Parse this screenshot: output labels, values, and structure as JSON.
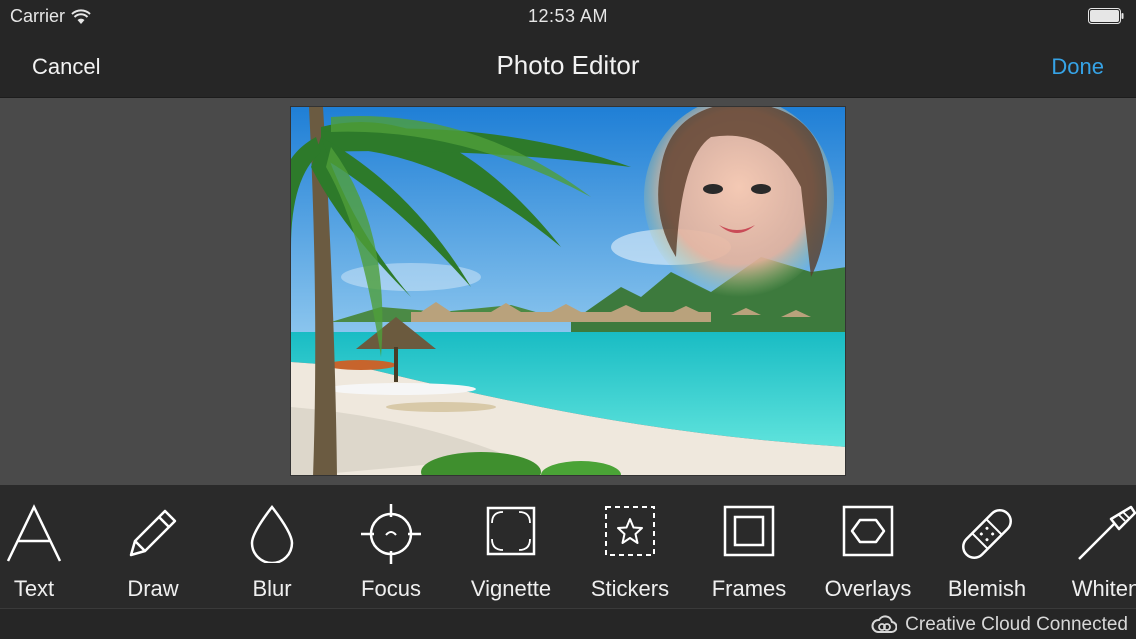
{
  "status": {
    "carrier": "Carrier",
    "time": "12:53 AM"
  },
  "nav": {
    "cancel": "Cancel",
    "title": "Photo Editor",
    "done": "Done"
  },
  "tools": [
    {
      "label": "Text",
      "icon": "text-icon"
    },
    {
      "label": "Draw",
      "icon": "pencil-icon"
    },
    {
      "label": "Blur",
      "icon": "drop-icon"
    },
    {
      "label": "Focus",
      "icon": "crosshair-icon"
    },
    {
      "label": "Vignette",
      "icon": "vignette-icon"
    },
    {
      "label": "Stickers",
      "icon": "star-icon"
    },
    {
      "label": "Frames",
      "icon": "frame-icon"
    },
    {
      "label": "Overlays",
      "icon": "hexagon-icon"
    },
    {
      "label": "Blemish",
      "icon": "bandage-icon"
    },
    {
      "label": "Whiten",
      "icon": "brush-icon"
    }
  ],
  "footer": {
    "cc_label": "Creative Cloud Connected"
  },
  "colors": {
    "accent": "#36a3e6",
    "background": "#262626",
    "canvas": "#4a4a4a"
  }
}
